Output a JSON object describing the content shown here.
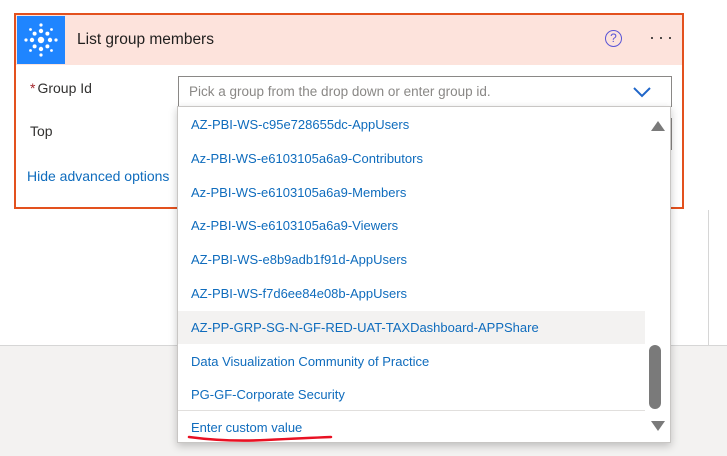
{
  "card": {
    "title": "List group members",
    "help_glyph": "?",
    "more_glyph": "···",
    "app_icon": "network-hub-icon",
    "accent_color": "#e3511e",
    "header_bg": "#fde3dc"
  },
  "fields": {
    "group_id": {
      "required_mark": "*",
      "label": "Group Id",
      "value": "",
      "placeholder": "Pick a group from the drop down or enter group id."
    },
    "top": {
      "label": "Top"
    }
  },
  "advanced": {
    "label": "Hide advanced options"
  },
  "dropdown": {
    "items": [
      "AZ-PBI-WS-c95e728655dc-AppUsers",
      "Az-PBI-WS-e6103105a6a9-Contributors",
      "Az-PBI-WS-e6103105a6a9-Members",
      "Az-PBI-WS-e6103105a6a9-Viewers",
      "AZ-PBI-WS-e8b9adb1f91d-AppUsers",
      "AZ-PBI-WS-f7d6ee84e08b-AppUsers",
      "AZ-PP-GRP-SG-N-GF-RED-UAT-TAXDashboard-APPShare",
      "Data Visualization Community of Practice",
      "PG-GF-Corporate Security"
    ],
    "highlighted_index": 6,
    "custom_value_label": "Enter custom value",
    "link_color": "#0f6cbd"
  }
}
